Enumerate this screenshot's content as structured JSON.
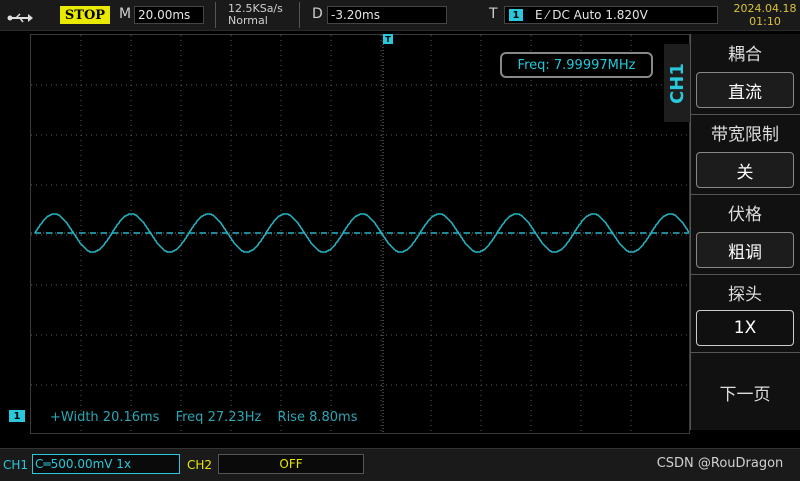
{
  "topbar": {
    "run_state": "STOP",
    "m_label": "M",
    "timebase": "20.00ms",
    "sample_rate": "12.5KSa/s",
    "acq_mode": "Normal",
    "d_label": "D",
    "delay": "-3.20ms",
    "t_label": "T",
    "trigger_channel": "1",
    "trigger_info": "E ⁄ DC Auto 1.820V",
    "date": "2024.04.18",
    "time": "01:10"
  },
  "scope": {
    "freq_readout": "Freq: 7.99997MHz",
    "measurements": [
      "+Width 20.16ms",
      "Freq 27.23Hz",
      "Rise 8.80ms"
    ],
    "channel_marker": "1",
    "trigger_marker": "T"
  },
  "side_menu": {
    "channel_tab": "CH1",
    "items": [
      {
        "title": "耦合",
        "value": "直流"
      },
      {
        "title": "带宽限制",
        "value": "关"
      },
      {
        "title": "伏格",
        "value": "粗调"
      },
      {
        "title": "探头",
        "value": "1X"
      }
    ],
    "next_page": "下一页"
  },
  "bottombar": {
    "ch1_label": "CH1",
    "ch1_value": "C═500.00mV 1x",
    "ch2_label": "CH2",
    "ch2_value": "OFF"
  },
  "watermark": "CSDN @RouDragon",
  "colors": {
    "trace": "#25b8c8",
    "stop_bg": "#e8e800",
    "grid_dot": "#5a5a5a"
  }
}
